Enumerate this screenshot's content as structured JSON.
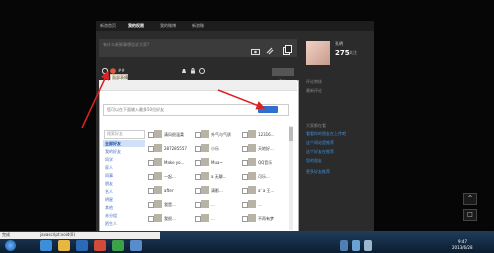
{
  "nav": {
    "tabs": [
      {
        "label": "新浪首页"
      },
      {
        "label": "我的权限"
      },
      {
        "label": "我的微博"
      },
      {
        "label": "新浪微"
      }
    ]
  },
  "compose": {
    "placeholder": "有什么新鲜事想告诉大家?"
  },
  "toolbar": {
    "tooltip": "面部表情",
    "publish_label": "发布"
  },
  "dialog": {
    "hint": "您可以在下面输入最多50位好友",
    "ok_label": "确定",
    "search_placeholder": "搜索好友",
    "groups": [
      "全部好友",
      "我的好友",
      "同学",
      "家人",
      "同事",
      "朋友",
      "名人",
      "明星",
      "其他",
      "未分组",
      "陌生人"
    ],
    "friends": [
      {
        "name": "清风很温柔"
      },
      {
        "name": "外气与气质"
      },
      {
        "name": "12316..."
      },
      {
        "name": "287285557"
      },
      {
        "name": "小乐"
      },
      {
        "name": "天地好..."
      },
      {
        "name": "Make yo..."
      },
      {
        "name": "Mua~"
      },
      {
        "name": "QQ音乐"
      },
      {
        "name": "一起..."
      },
      {
        "name": "a 无聊..."
      },
      {
        "name": "可乐..."
      },
      {
        "name": "after"
      },
      {
        "name": "清影..."
      },
      {
        "name": "a' a 王..."
      },
      {
        "name": "我是..."
      },
      {
        "name": "..."
      },
      {
        "name": "..."
      },
      {
        "name": "我很..."
      },
      {
        "name": "..."
      },
      {
        "name": "不再有梦"
      }
    ]
  },
  "profile": {
    "name": "孔明",
    "stat_number": "275",
    "stat_label": "关注"
  },
  "right": {
    "lines": [
      "评论审核",
      "最新评论",
      ""
    ],
    "section2": "大家都在看",
    "links": [
      "看看你的朋友在上传吧",
      "这个网站是推荐",
      "这个好友在推荐",
      "您的朋友"
    ],
    "more": "更多好友推荐"
  },
  "statusbar": {
    "left_text": "完成",
    "url_text": "javascript:void(0)"
  },
  "taskbar": {
    "time": "9:47",
    "date": "2013/6/28"
  }
}
